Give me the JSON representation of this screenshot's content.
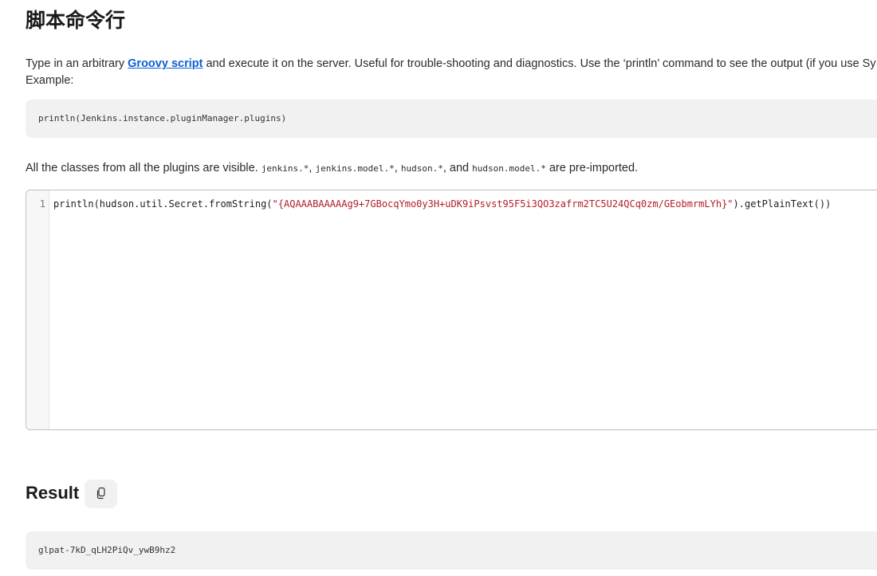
{
  "page": {
    "title": "脚本命令行"
  },
  "description": {
    "prefix": "Type in an arbitrary ",
    "link_text": "Groovy script",
    "suffix": " and execute it on the server. Useful for trouble-shooting and diagnostics. Use the ‘println’ command to see the output (if you use Sy",
    "line2": "Example:"
  },
  "example": {
    "code": "println(Jenkins.instance.pluginManager.plugins)"
  },
  "preimport": {
    "prefix": "All the classes from all the plugins are visible. ",
    "pkg1": "jenkins.*",
    "sep1": ", ",
    "pkg2": "jenkins.model.*",
    "sep2": ", ",
    "pkg3": "hudson.*",
    "sep3": ", and ",
    "pkg4": "hudson.model.*",
    "suffix": " are pre-imported."
  },
  "editor": {
    "line_number": "1",
    "code_before": "println(hudson.util.Secret.fromString(",
    "code_string": "\"{AQAAABAAAAAg9+7GBocqYmo0y3H+uDK9iPsvst95F5i3QO3zafrm2TC5U24QCq0zm/GEobmrmLYh}\"",
    "code_after": ").getPlainText())",
    "string_color": "#b31d28"
  },
  "result": {
    "title": "Result",
    "copy_icon": "copy-icon",
    "output": "glpat-7kD_qLH2PiQv_ywB9hz2"
  }
}
